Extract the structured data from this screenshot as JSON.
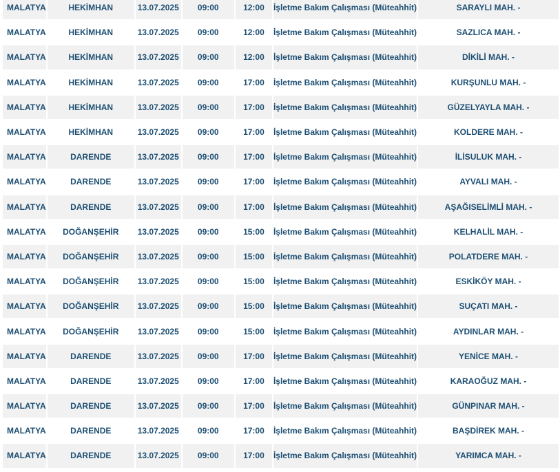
{
  "table": {
    "rows": [
      {
        "il": "MALATYA",
        "ilce": "HEKİMHAN",
        "tarih": "13.07.2025",
        "baslangic": "09:00",
        "bitis": "12:00",
        "neden": "İşletme Bakım Çalışması (Müteahhit)",
        "mahalle": "SARAYLI MAH. -"
      },
      {
        "il": "MALATYA",
        "ilce": "HEKİMHAN",
        "tarih": "13.07.2025",
        "baslangic": "09:00",
        "bitis": "12:00",
        "neden": "İşletme Bakım Çalışması (Müteahhit)",
        "mahalle": "SAZLICA MAH. -"
      },
      {
        "il": "MALATYA",
        "ilce": "HEKİMHAN",
        "tarih": "13.07.2025",
        "baslangic": "09:00",
        "bitis": "12:00",
        "neden": "İşletme Bakım Çalışması (Müteahhit)",
        "mahalle": "DİKİLİ MAH. -"
      },
      {
        "il": "MALATYA",
        "ilce": "HEKİMHAN",
        "tarih": "13.07.2025",
        "baslangic": "09:00",
        "bitis": "17:00",
        "neden": "İşletme Bakım Çalışması (Müteahhit)",
        "mahalle": "KURŞUNLU MAH. -"
      },
      {
        "il": "MALATYA",
        "ilce": "HEKİMHAN",
        "tarih": "13.07.2025",
        "baslangic": "09:00",
        "bitis": "17:00",
        "neden": "İşletme Bakım Çalışması (Müteahhit)",
        "mahalle": "GÜZELYAYLA MAH. -"
      },
      {
        "il": "MALATYA",
        "ilce": "HEKİMHAN",
        "tarih": "13.07.2025",
        "baslangic": "09:00",
        "bitis": "17:00",
        "neden": "İşletme Bakım Çalışması (Müteahhit)",
        "mahalle": "KOLDERE MAH. -"
      },
      {
        "il": "MALATYA",
        "ilce": "DARENDE",
        "tarih": "13.07.2025",
        "baslangic": "09:00",
        "bitis": "17:00",
        "neden": "İşletme Bakım Çalışması (Müteahhit)",
        "mahalle": "İLİSULUK MAH. -"
      },
      {
        "il": "MALATYA",
        "ilce": "DARENDE",
        "tarih": "13.07.2025",
        "baslangic": "09:00",
        "bitis": "17:00",
        "neden": "İşletme Bakım Çalışması (Müteahhit)",
        "mahalle": "AYVALI MAH. -"
      },
      {
        "il": "MALATYA",
        "ilce": "DARENDE",
        "tarih": "13.07.2025",
        "baslangic": "09:00",
        "bitis": "17:00",
        "neden": "İşletme Bakım Çalışması (Müteahhit)",
        "mahalle": "AŞAĞISELİMLİ MAH. -"
      },
      {
        "il": "MALATYA",
        "ilce": "DOĞANŞEHİR",
        "tarih": "13.07.2025",
        "baslangic": "09:00",
        "bitis": "15:00",
        "neden": "İşletme Bakım Çalışması (Müteahhit)",
        "mahalle": "KELHALİL MAH. -"
      },
      {
        "il": "MALATYA",
        "ilce": "DOĞANŞEHİR",
        "tarih": "13.07.2025",
        "baslangic": "09:00",
        "bitis": "15:00",
        "neden": "İşletme Bakım Çalışması (Müteahhit)",
        "mahalle": "POLATDERE MAH. -"
      },
      {
        "il": "MALATYA",
        "ilce": "DOĞANŞEHİR",
        "tarih": "13.07.2025",
        "baslangic": "09:00",
        "bitis": "15:00",
        "neden": "İşletme Bakım Çalışması (Müteahhit)",
        "mahalle": "ESKİKÖY MAH. -"
      },
      {
        "il": "MALATYA",
        "ilce": "DOĞANŞEHİR",
        "tarih": "13.07.2025",
        "baslangic": "09:00",
        "bitis": "15:00",
        "neden": "İşletme Bakım Çalışması (Müteahhit)",
        "mahalle": "SUÇATI MAH. -"
      },
      {
        "il": "MALATYA",
        "ilce": "DOĞANŞEHİR",
        "tarih": "13.07.2025",
        "baslangic": "09:00",
        "bitis": "15:00",
        "neden": "İşletme Bakım Çalışması (Müteahhit)",
        "mahalle": "AYDINLAR MAH. -"
      },
      {
        "il": "MALATYA",
        "ilce": "DARENDE",
        "tarih": "13.07.2025",
        "baslangic": "09:00",
        "bitis": "17:00",
        "neden": "İşletme Bakım Çalışması (Müteahhit)",
        "mahalle": "YENİCE MAH. -"
      },
      {
        "il": "MALATYA",
        "ilce": "DARENDE",
        "tarih": "13.07.2025",
        "baslangic": "09:00",
        "bitis": "17:00",
        "neden": "İşletme Bakım Çalışması (Müteahhit)",
        "mahalle": "KARAOĞUZ MAH. -"
      },
      {
        "il": "MALATYA",
        "ilce": "DARENDE",
        "tarih": "13.07.2025",
        "baslangic": "09:00",
        "bitis": "17:00",
        "neden": "İşletme Bakım Çalışması (Müteahhit)",
        "mahalle": "GÜNPINAR MAH. -"
      },
      {
        "il": "MALATYA",
        "ilce": "DARENDE",
        "tarih": "13.07.2025",
        "baslangic": "09:00",
        "bitis": "17:00",
        "neden": "İşletme Bakım Çalışması (Müteahhit)",
        "mahalle": "BAŞDİREK MAH. -"
      },
      {
        "il": "MALATYA",
        "ilce": "DARENDE",
        "tarih": "13.07.2025",
        "baslangic": "09:00",
        "bitis": "17:00",
        "neden": "İşletme Bakım Çalışması (Müteahhit)",
        "mahalle": "YARIMCA MAH. -"
      }
    ]
  },
  "colors": {
    "text": "#1d4f73",
    "row_stripe": "#f1f1f1",
    "row_plain": "#ffffff"
  }
}
